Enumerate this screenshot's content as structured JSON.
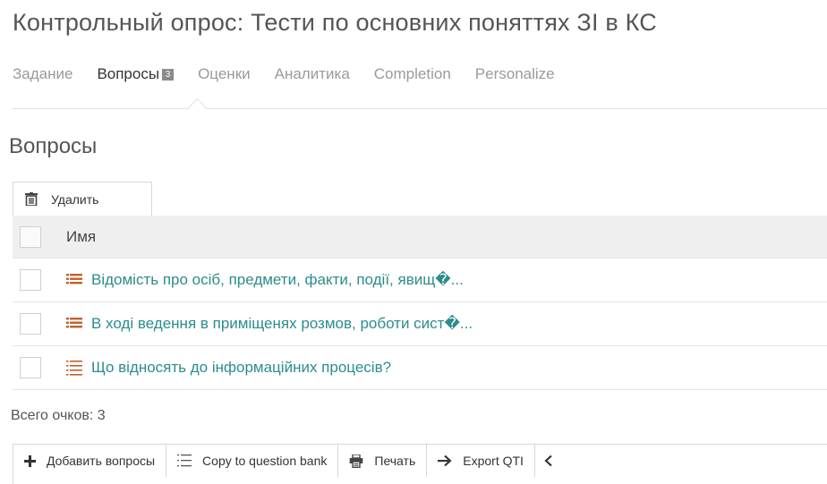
{
  "page": {
    "title": "Контрольный опрос: Тести по основних поняттях ЗІ в КС"
  },
  "tabs": [
    {
      "label": "Задание",
      "active": false
    },
    {
      "label": "Вопросы",
      "badge": "3",
      "active": true
    },
    {
      "label": "Оценки",
      "active": false
    },
    {
      "label": "Аналитика",
      "active": false
    },
    {
      "label": "Completion",
      "active": false
    },
    {
      "label": "Personalize",
      "active": false
    }
  ],
  "questions_section": {
    "heading": "Вопросы",
    "delete_label": "Удалить",
    "column_name": "Имя",
    "rows": [
      {
        "title": "Відомість про осіб, предмети, факти, події, явищ�...",
        "icon": "list-icon"
      },
      {
        "title": "В ході ведення в приміщенях розмов, роботи сист�...",
        "icon": "list-icon"
      },
      {
        "title": "Що відносять до інформаційних процесів?",
        "icon": "list-outline-icon"
      }
    ],
    "total_points": "Всего очков: 3"
  },
  "toolbar": {
    "add_label": "Добавить вопросы",
    "copy_label": "Copy to question bank",
    "print_label": "Печать",
    "export_label": "Export QTI"
  },
  "colors": {
    "link": "#2c8c8c",
    "list_icon": "#c0612b",
    "badge": "#8a8a8a"
  }
}
